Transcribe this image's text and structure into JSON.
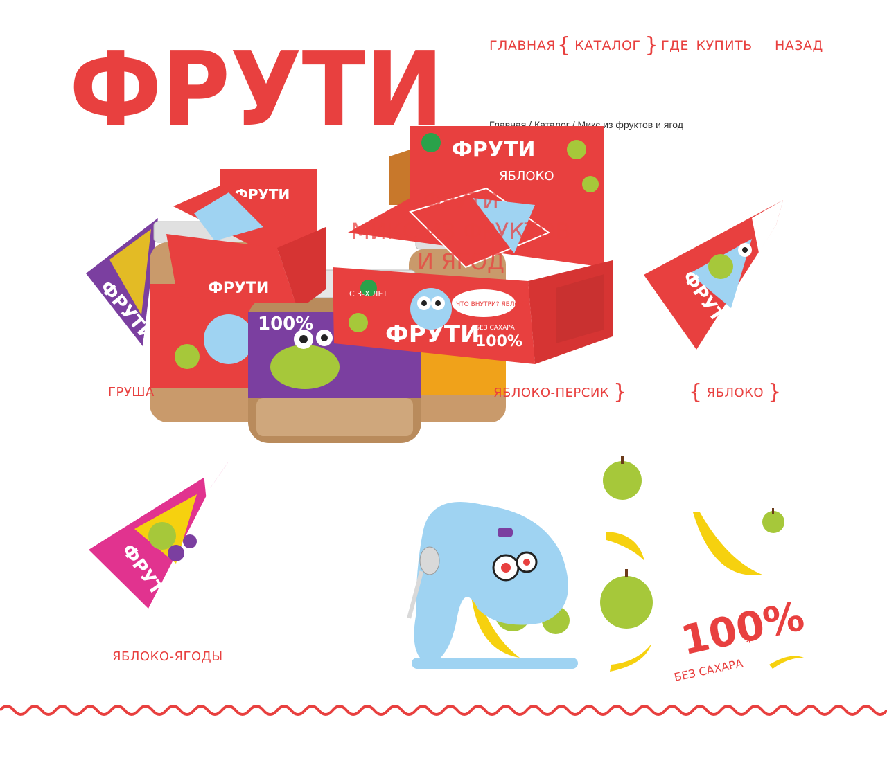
{
  "brand": {
    "logo_text": "ФРУТИ"
  },
  "nav": {
    "items": [
      {
        "label": "ГЛАВНАЯ",
        "active": false
      },
      {
        "label": "КАТАЛОГ",
        "active": true
      },
      {
        "label": "ГДЕ КУПИТЬ",
        "active": false
      },
      {
        "label": "НАЗАД",
        "active": false
      }
    ]
  },
  "breadcrumb": {
    "items": [
      "Главная",
      "Каталог",
      "Микс из фруктов и ягод"
    ],
    "separator": " / "
  },
  "hero": {
    "title_lines": [
      "ФРУТИ",
      "МИКС ИЗ ФРУКТОВ",
      "И ЯГОД"
    ],
    "box_brand": "ФРУТИ",
    "box_flavor": "ЯБЛОКО",
    "box_age": "С 3-Х ЛЕТ",
    "box_badge": "ЧТО ВНУТРИ? ЯБЛОКО",
    "box_percent": "100%",
    "box_sugar": "БЕЗ САХАРА",
    "jar_percent": "100%"
  },
  "products": [
    {
      "label": "ГРУША",
      "pack_text": "ФРУТИ",
      "active": false
    },
    {
      "label": "ЯБЛОКО-ПЕРСИК",
      "pack_text": "ФРУТИ",
      "active": true
    },
    {
      "label": "ЯБЛОКО",
      "pack_text": "ФРУТИ",
      "active": true
    },
    {
      "label": "ЯБЛОКО-ЯГОДЫ",
      "pack_text": "ФРУТИ",
      "active": false
    }
  ],
  "promo": {
    "percent": "100%",
    "caption": "БЕЗ САХАРА",
    "mark": "*"
  },
  "colors": {
    "brand_red": "#e8403f",
    "jar_purple": "#7b3fa0",
    "apple_green": "#a6c83a",
    "banana": "#f6d10f",
    "monster_blue": "#9fd3f2",
    "pink_pack": "#e1338f"
  }
}
